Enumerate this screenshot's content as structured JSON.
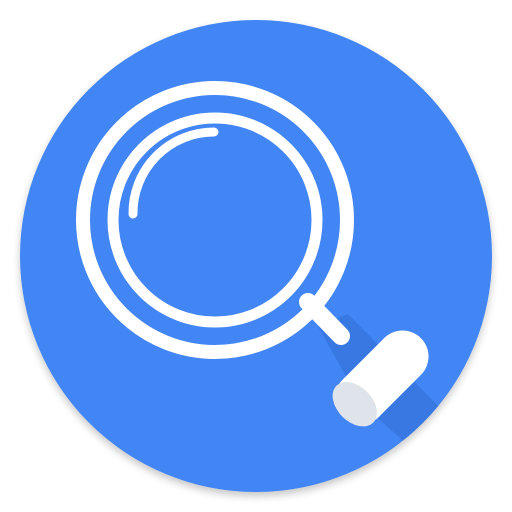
{
  "app_icon": {
    "name": "magnifier-app-icon",
    "symbol": "magnifying-glass-icon",
    "colors": {
      "background": "#ffffff",
      "circle": "#4285f4",
      "glyph": "#ffffff",
      "shadow": "#2f6ed6",
      "handle_cap": "#dfe4ea"
    }
  }
}
